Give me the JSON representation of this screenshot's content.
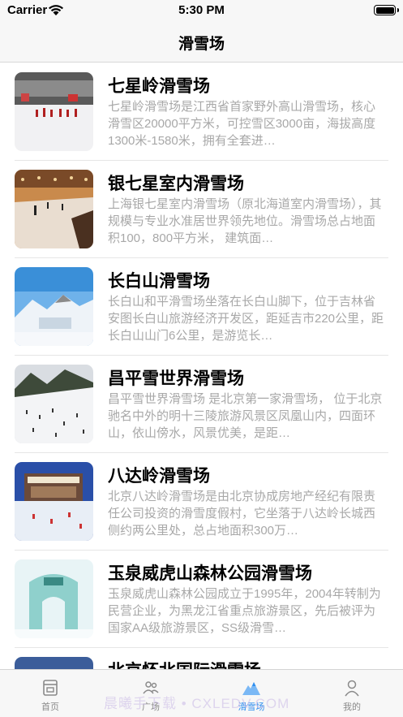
{
  "status_bar": {
    "carrier": "Carrier",
    "time": "5:30 PM"
  },
  "nav": {
    "title": "滑雪场"
  },
  "resorts": [
    {
      "title": "七星岭滑雪场",
      "description": "七星岭滑雪场是江西省首家野外高山滑雪场，核心滑雪区20000平方米，可控雪区3000亩，海拔高度1300米-1580米，拥有全套进…"
    },
    {
      "title": "银七星室内滑雪场",
      "description": "上海银七星室内滑雪场（原北海道室内滑雪场），其规模与专业水准居世界领先地位。滑雪场总占地面积100，800平方米， 建筑面…"
    },
    {
      "title": "长白山滑雪场",
      "description": "长白山和平滑雪场坐落在长白山脚下，位于吉林省安图长白山旅游经济开发区，距延吉市220公里，距长白山山门6公里，是游览长…"
    },
    {
      "title": "昌平雪世界滑雪场",
      "description": "昌平雪世界滑雪场 是北京第一家滑雪场， 位于北京驰名中外的明十三陵旅游风景区凤凰山内，四面环山，依山傍水，风景优美，是距…"
    },
    {
      "title": "八达岭滑雪场",
      "description": "北京八达岭滑雪场是由北京协成房地产经纪有限责任公司投资的滑雪度假村，它坐落于八达岭长城西侧约两公里处，总占地面积300万…"
    },
    {
      "title": "玉泉威虎山森林公园滑雪场",
      "description": "玉泉威虎山森林公园成立于1995年，2004年转制为民营企业，为黑龙江省重点旅游景区，先后被评为国家AA级旅游景区，SS级滑雪…"
    },
    {
      "title": "北京怀北国际滑雪场",
      "description": ""
    }
  ],
  "tabs": [
    {
      "label": "首页",
      "icon": "home-icon"
    },
    {
      "label": "广场",
      "icon": "people-icon"
    },
    {
      "label": "滑雪场",
      "icon": "mountain-icon"
    },
    {
      "label": "我的",
      "icon": "person-icon"
    }
  ],
  "watermark": "晨曦手下载 • CXLEDV.COM",
  "colors": {
    "accent": "#2f8ff0",
    "bars": "#f7f7f7",
    "description": "#a8a8a8"
  }
}
